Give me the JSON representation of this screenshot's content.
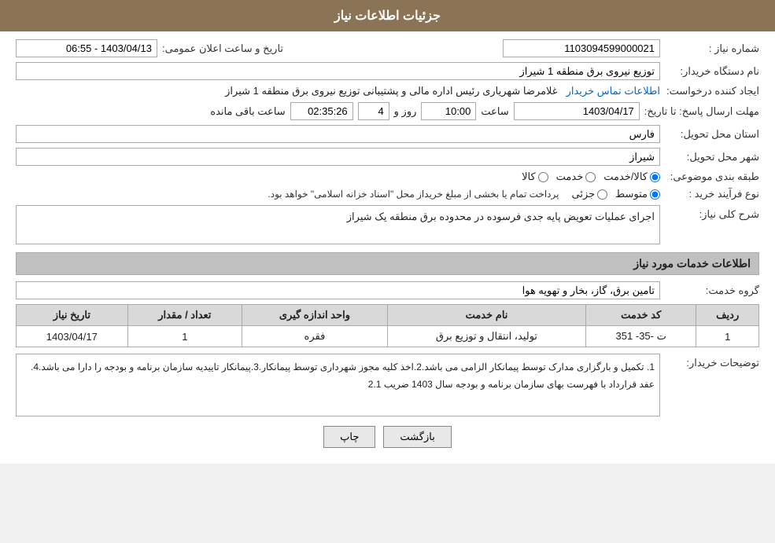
{
  "header": {
    "title": "جزئیات اطلاعات نیاز"
  },
  "fields": {
    "shomara_niyaz_label": "شماره نیاز :",
    "shomara_niyaz_value": "1103094599000021",
    "nam_dastgah_label": "نام دستگاه خریدار:",
    "nam_dastgah_value": "توزیع نیروی برق منطقه 1 شیراز",
    "creator_label": "ایجاد کننده درخواست:",
    "creator_value": "غلامرضا شهریاری رئیس اداره مالی و پشتیبانی  توزیع نیروی برق منطقه 1 شیراز",
    "creator_link": "اطلاعات تماس خریدار",
    "mohlat_label": "مهلت ارسال پاسخ: تا تاریخ:",
    "mohlat_date": "1403/04/17",
    "mohlat_time_label": "ساعت",
    "mohlat_time": "10:00",
    "mohlat_roz_label": "روز و",
    "mohlat_roz_value": "4",
    "mohlat_saat_manде_label": "ساعت باقی مانده",
    "mohlat_countdown": "02:35:26",
    "tarikh_label": "تاریخ و ساعت اعلان عمومی:",
    "tarikh_value": "1403/04/13 - 06:55",
    "ostan_label": "استان محل تحویل:",
    "ostan_value": "فارس",
    "shahr_label": "شهر محل تحویل:",
    "shahr_value": "شیراز",
    "tabaqe_label": "طبقه بندی موضوعی:",
    "radio_kala_label": "کالا",
    "radio_khadamat_label": "خدمت",
    "radio_kala_khadamat_label": "کالا/خدمت",
    "radio_kala_khadamat_selected": "kala_khadamat",
    "noeFarayand_label": "نوع فرآیند خرید :",
    "radio_jozii_label": "جزئی",
    "radio_motavasset_label": "متوسط",
    "radio_farayand_selected": "motavasset",
    "farayand_note": "پرداخت تمام یا بخشی از مبلغ خریداز محل \"اسناد خزانه اسلامی\" خواهد بود.",
    "sharh_label": "شرح کلی نیاز:",
    "sharh_value": "اجرای عملیات تعویض پایه جدی فرسوده در محدوده برق منطقه یک شیراز",
    "section2_title": "اطلاعات خدمات مورد نیاز",
    "grouh_label": "گروه خدمت:",
    "grouh_value": "تامین برق، گاز، بخار و تهویه هوا",
    "table": {
      "headers": [
        "ردیف",
        "کد خدمت",
        "نام خدمت",
        "واحد اندازه گیری",
        "تعداد / مقدار",
        "تاریخ نیاز"
      ],
      "rows": [
        {
          "radif": "1",
          "kod_khadamat": "ت -35- 351",
          "nam_khadamat": "تولید، انتقال و توزیع برق",
          "vahed": "فقره",
          "tedad": "1",
          "tarikh": "1403/04/17"
        }
      ]
    },
    "tawsif_label": "توضیحات خریدار:",
    "tawsif_value": "1. تکمیل و بارگزاری مدارک توسط پیمانکار الزامی می باشد.2.اخذ کلیه مجوز شهرداری توسط پیمانکار.3.پیمانکار تاییدیه سازمان برنامه و بودجه را دارا می باشد.4. عفد قرارداد با فهرست بهای سازمان برنامه و بودجه سال 1403 ضریب 2.1",
    "btn_chap": "چاپ",
    "btn_bazgasht": "بازگشت"
  }
}
